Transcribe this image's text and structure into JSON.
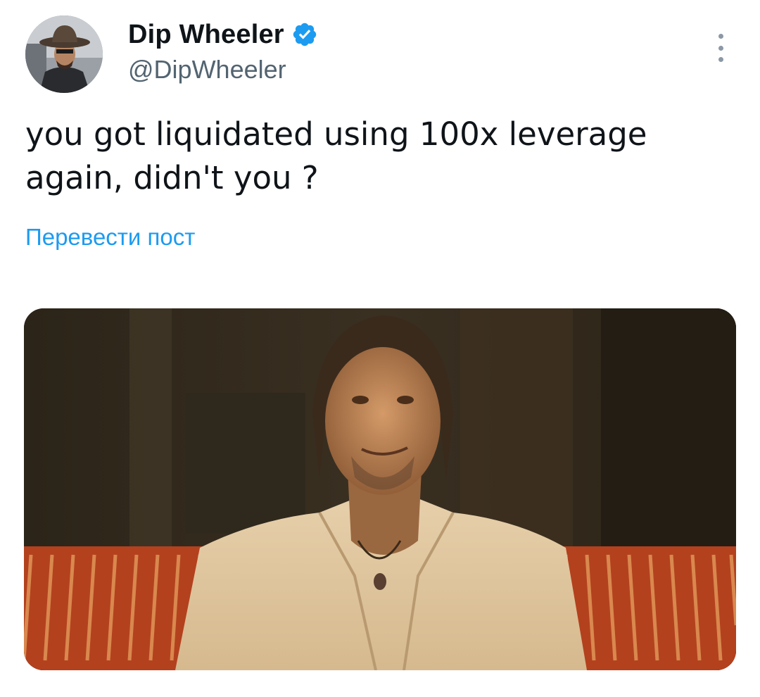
{
  "author": {
    "display_name": "Dip Wheeler",
    "handle": "@DipWheeler",
    "verified": true,
    "avatar_icon": "avatar-cowboy-hat-photo"
  },
  "post": {
    "text": "you got liquidated using 100x leverage again, didn't you ?",
    "translate_label": "Перевести пост",
    "media_description_icon": "photo-man-on-couch"
  },
  "menu": {
    "icon": "more-vertical-icon"
  },
  "colors": {
    "text": "#0f1419",
    "secondary": "#536471",
    "link": "#1d9bf0",
    "verified": "#1d9bf0"
  }
}
